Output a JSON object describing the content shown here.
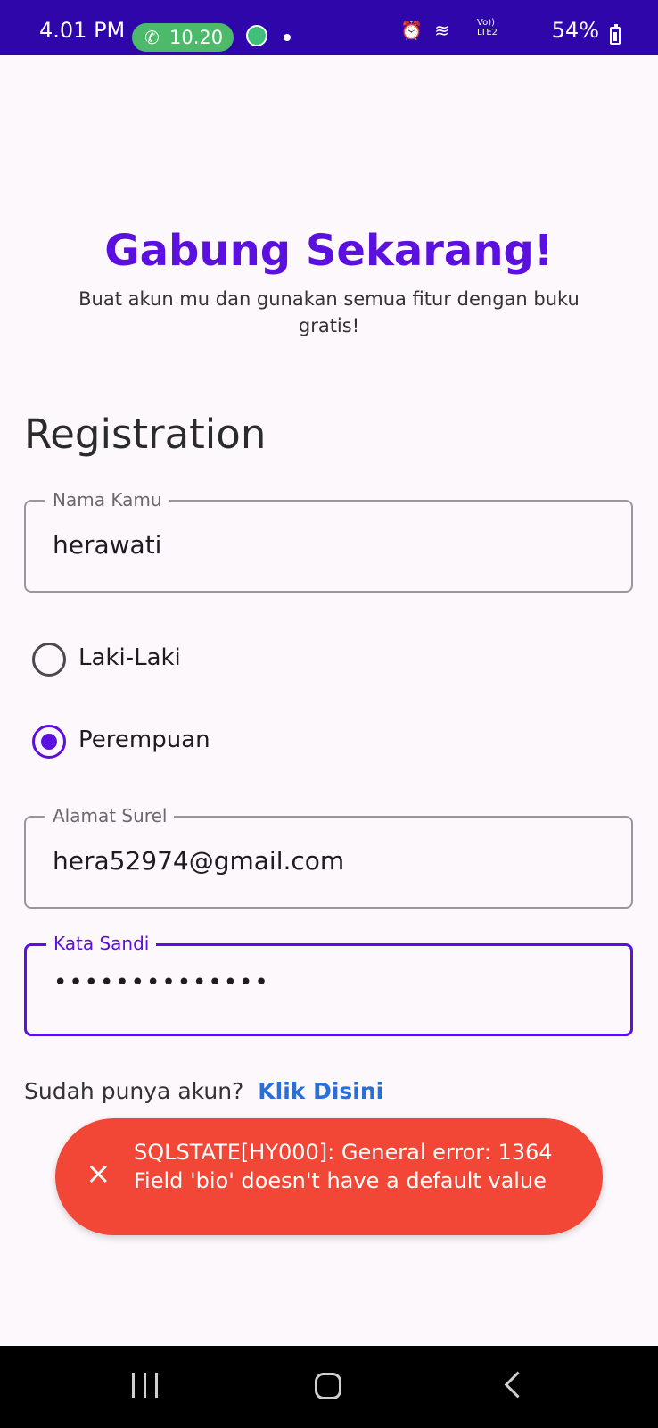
{
  "status_bar": {
    "time": "4.01 PM",
    "call_timer": "10.20",
    "signal_text": "Vo)) LTE2",
    "battery": "54%",
    "icons": [
      "phone-icon",
      "app-notification-icon",
      "alarm-icon",
      "wifi-icon",
      "signal-icon",
      "battery-icon"
    ]
  },
  "header": {
    "title": "Gabung Sekarang!",
    "subtitle": "Buat akun mu dan gunakan semua fitur dengan buku gratis!"
  },
  "form": {
    "section_title": "Registration",
    "name_field": {
      "label": "Nama Kamu",
      "value": "herawati"
    },
    "gender": {
      "options": [
        {
          "label": "Laki-Laki",
          "checked": false
        },
        {
          "label": "Perempuan",
          "checked": true
        }
      ]
    },
    "email_field": {
      "label": "Alamat Surel",
      "value": "hera52974@gmail.com"
    },
    "password_field": {
      "label": "Kata Sandi",
      "value": "••••••••••••••"
    },
    "login_prompt": "Sudah punya akun?",
    "login_link": "Klik Disini"
  },
  "toast": {
    "message": "SQLSTATE[HY000]: General error: 1364 Field 'bio' doesn't have a default value",
    "close_icon": "×"
  },
  "colors": {
    "primary": "#5b10e0",
    "status_bar": "#2e06aa",
    "error": "#f24637",
    "link": "#2a6fd8",
    "background": "#fdf8fc"
  }
}
